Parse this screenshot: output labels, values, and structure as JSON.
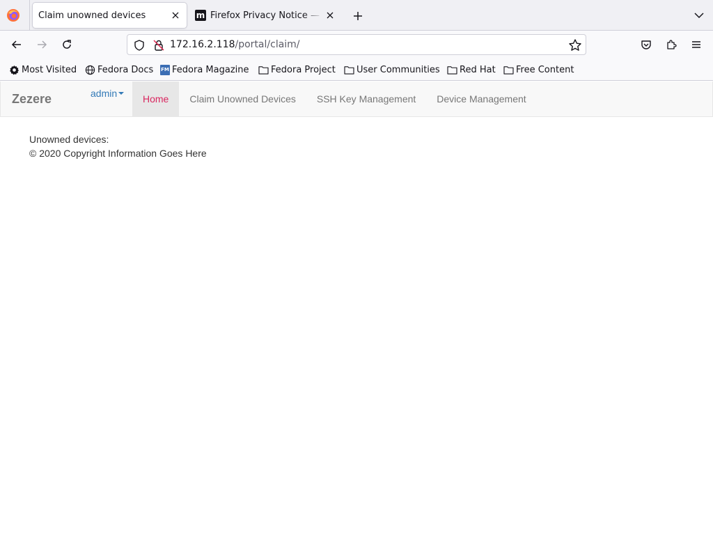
{
  "browser": {
    "tabs": [
      {
        "title": "Claim unowned devices",
        "active": true
      },
      {
        "title": "Firefox Privacy Notice — Mozilla",
        "favicon_letter": "m",
        "active": false
      }
    ],
    "url": {
      "host": "172.16.2.118",
      "path": "/portal/claim/"
    },
    "bookmarks": [
      {
        "label": "Most Visited",
        "icon": "gear-icon"
      },
      {
        "label": "Fedora Docs",
        "icon": "globe-icon"
      },
      {
        "label": "Fedora Magazine",
        "icon": "fedora-magazine-icon",
        "icon_text": "FM"
      },
      {
        "label": "Fedora Project",
        "icon": "folder-icon"
      },
      {
        "label": "User Communities",
        "icon": "folder-icon"
      },
      {
        "label": "Red Hat",
        "icon": "folder-icon"
      },
      {
        "label": "Free Content",
        "icon": "folder-icon"
      }
    ]
  },
  "site": {
    "brand": "Zezere",
    "user_menu": "admin",
    "nav": [
      {
        "label": "Home",
        "active": true
      },
      {
        "label": "Claim Unowned Devices",
        "active": false
      },
      {
        "label": "SSH Key Management",
        "active": false
      },
      {
        "label": "Device Management",
        "active": false
      }
    ],
    "content": {
      "unowned_label": "Unowned devices:",
      "footer": "© 2020 Copyright Information Goes Here"
    }
  },
  "colors": {
    "link": "#337ab7",
    "nav_active_text": "#d9265f",
    "nav_active_bg": "#e7e7e7",
    "brand_text": "#777777"
  }
}
